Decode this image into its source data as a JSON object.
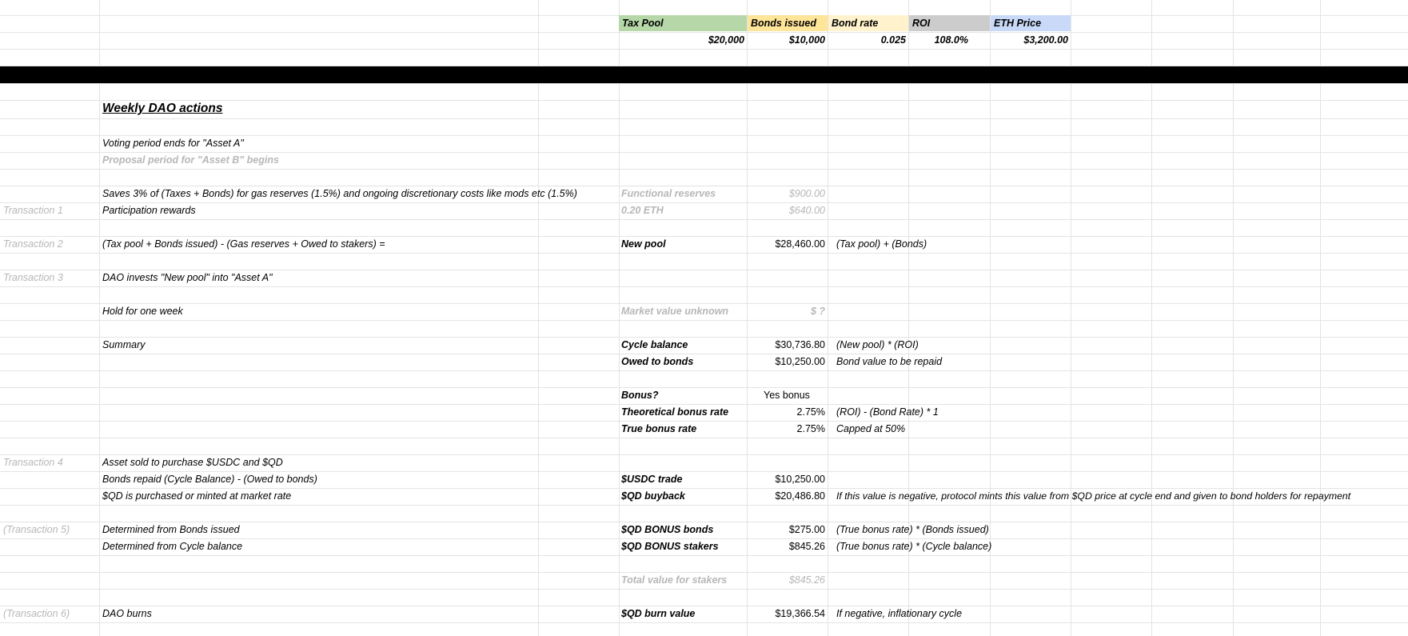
{
  "header": {
    "tax_pool_label": "Tax Pool",
    "bonds_issued_label": "Bonds issued",
    "bond_rate_label": "Bond rate",
    "roi_label": "ROI",
    "eth_price_label": "ETH Price",
    "tax_pool_value": "$20,000",
    "bonds_issued_value": "$10,000",
    "bond_rate_value": "0.025",
    "roi_value": "108.0%",
    "eth_price_value": "$3,200.00",
    "colors": {
      "tax_pool": "#b6d7a8",
      "bonds_issued": "#ffe599",
      "bond_rate": "#fff2cc",
      "roi": "#cccccc",
      "eth_price": "#c9daf8"
    }
  },
  "title": "Weekly DAO actions",
  "rows": {
    "voting": "Voting period ends for \"Asset A\"",
    "proposal": "Proposal period for \"Asset B\" begins",
    "saves": "Saves 3% of (Taxes + Bonds) for gas reserves (1.5%) and ongoing discretionary costs like mods etc (1.5%)",
    "functional_reserves_label": "Functional reserves",
    "functional_reserves_value": "$900.00",
    "t1_label": "Transaction 1",
    "t1_desc": "Participation rewards",
    "eth_amount": "0.20 ETH",
    "eth_value": "$640.00",
    "t2_label": "Transaction 2",
    "t2_desc": "(Tax pool + Bonds issued) - (Gas reserves + Owed to stakers) =",
    "new_pool_label": "New pool",
    "new_pool_value": "$28,460.00",
    "new_pool_note": "(Tax pool) + (Bonds)",
    "t3_label": "Transaction 3",
    "t3_desc": "DAO invests \"New pool\" into \"Asset A\"",
    "hold_desc": "Hold for one week",
    "market_label": "Market value unknown",
    "market_value": "$ ?",
    "summary_desc": "Summary",
    "cycle_balance_label": "Cycle balance",
    "cycle_balance_value": "$30,736.80",
    "cycle_balance_note": "(New pool) * (ROI)",
    "owed_bonds_label": "Owed to bonds",
    "owed_bonds_value": "$10,250.00",
    "owed_bonds_note": "Bond value to be repaid",
    "bonus_label": "Bonus?",
    "bonus_value": "Yes bonus",
    "theoretical_label": "Theoretical bonus rate",
    "theoretical_value": "2.75%",
    "theoretical_note": "(ROI) - (Bond Rate) * 1",
    "true_bonus_label": "True bonus rate",
    "true_bonus_value": "2.75%",
    "true_bonus_note": "Capped at 50%",
    "t4_label": "Transaction 4",
    "t4_desc": "Asset sold to purchase $USDC and $QD",
    "bonds_repaid_desc": "Bonds repaid (Cycle Balance) - (Owed to bonds)",
    "usdc_label": "$USDC trade",
    "usdc_value": "$10,250.00",
    "qd_purchase_desc": "$QD is purchased or minted at market rate",
    "qd_buyback_label": "$QD buyback",
    "qd_buyback_value": "$20,486.80",
    "qd_buyback_note": "If this value is negative, protocol mints this value from $QD price at cycle end and given to bond holders for repayment",
    "t5_label": "(Transaction 5)",
    "t5_desc": "Determined from Bonds issued",
    "bonus_bonds_label": "$QD BONUS bonds",
    "bonus_bonds_value": "$275.00",
    "bonus_bonds_note": "(True bonus rate) * (Bonds issued)",
    "cycle_det_desc": "Determined from Cycle balance",
    "bonus_stakers_label": "$QD BONUS stakers",
    "bonus_stakers_value": "$845.26",
    "bonus_stakers_note": "(True bonus rate) * (Cycle balance)",
    "total_stakers_label": "Total value for stakers",
    "total_stakers_value": "$845.26",
    "t6_label": "(Transaction 6)",
    "t6_desc": "DAO burns",
    "burn_label": "$QD burn value",
    "burn_value": "$19,366.54",
    "burn_note": "If negative, inflationary cycle"
  }
}
